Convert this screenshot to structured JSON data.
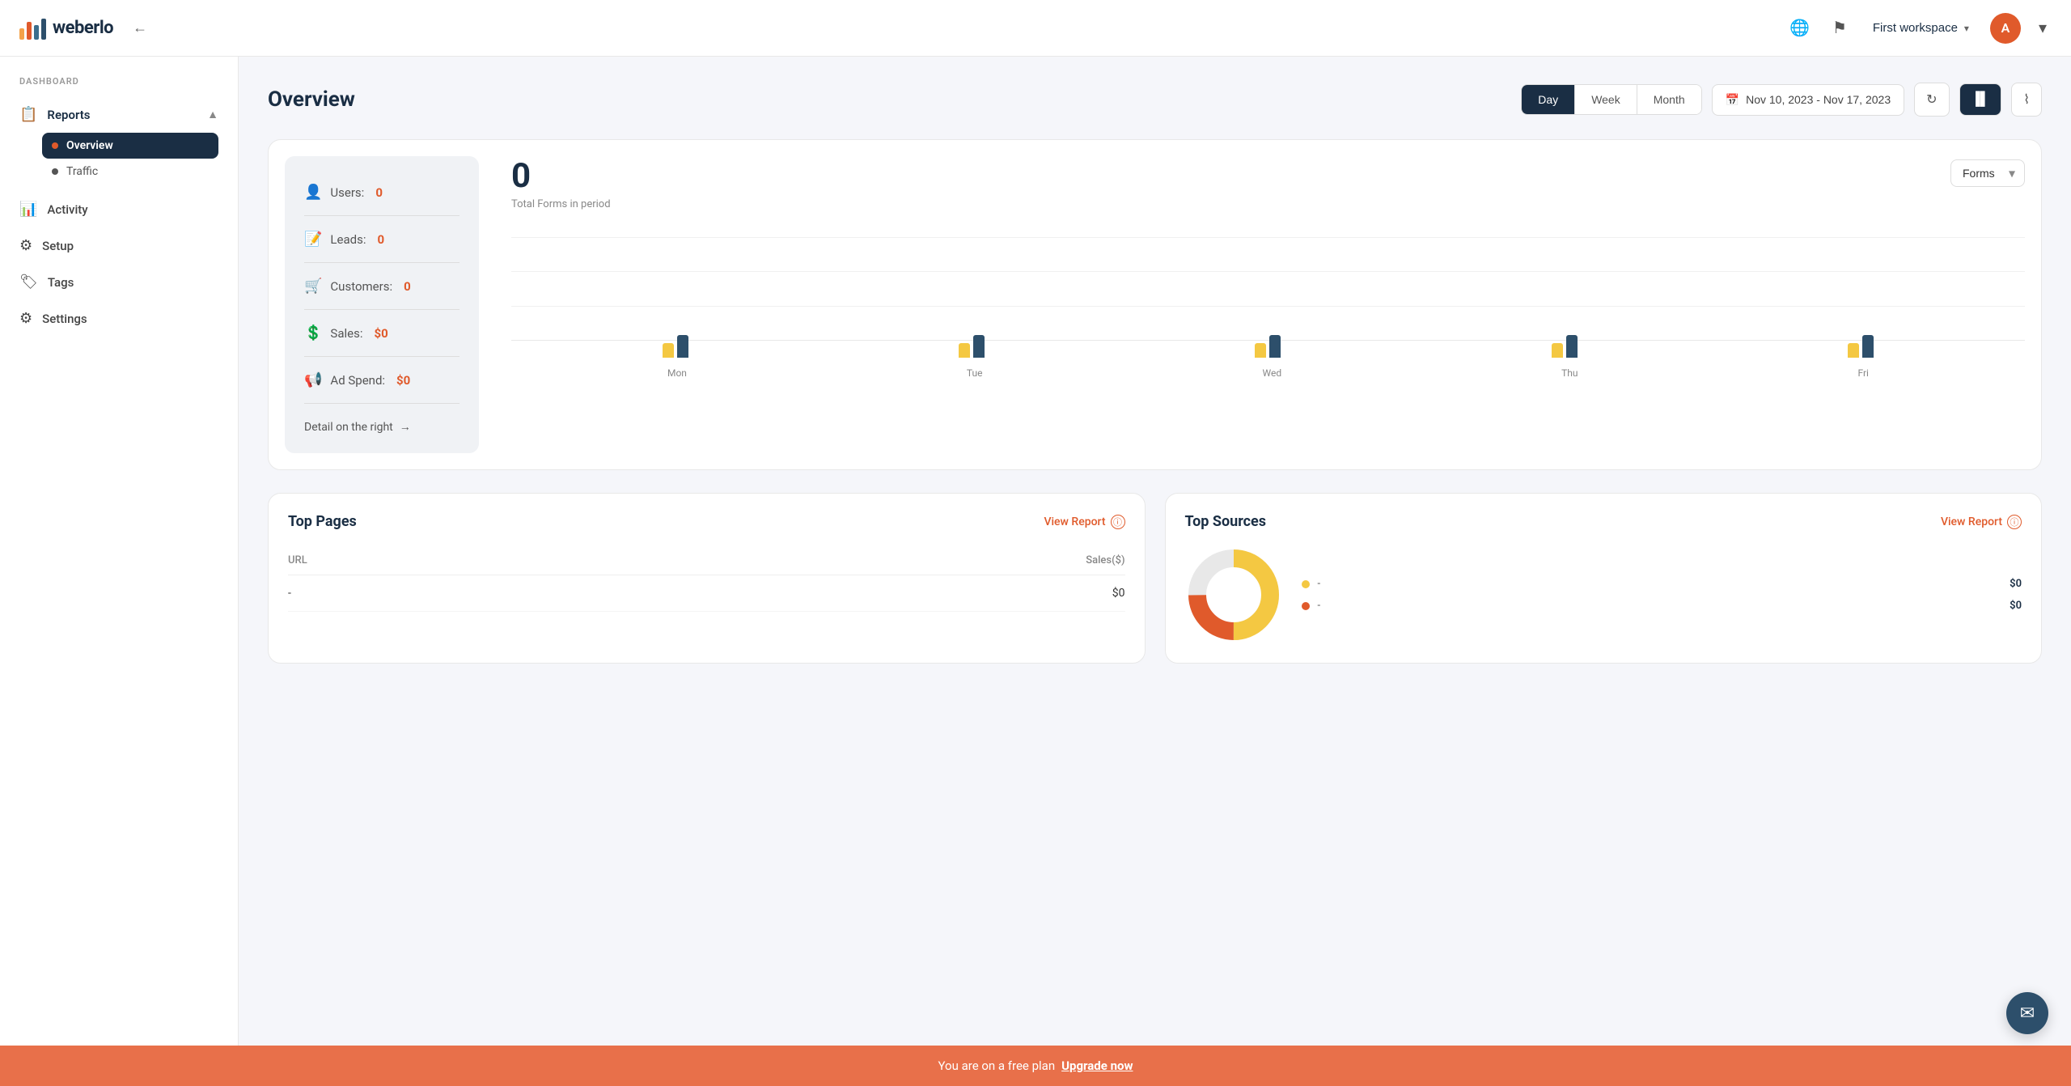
{
  "topbar": {
    "logo_text": "weberlo",
    "back_label": "←",
    "workspace_name": "First workspace",
    "avatar_letter": "A"
  },
  "sidebar": {
    "section_label": "DASHBOARD",
    "items": [
      {
        "id": "reports",
        "label": "Reports",
        "icon": "📋",
        "expanded": true
      },
      {
        "id": "overview",
        "label": "Overview",
        "active": true
      },
      {
        "id": "traffic",
        "label": "Traffic"
      },
      {
        "id": "activity",
        "label": "Activity",
        "icon": "📊"
      },
      {
        "id": "setup",
        "label": "Setup",
        "icon": "⚙"
      },
      {
        "id": "tags",
        "label": "Tags",
        "icon": "🏷"
      },
      {
        "id": "settings",
        "label": "Settings",
        "icon": "⚙"
      }
    ]
  },
  "overview": {
    "title": "Overview",
    "period_buttons": [
      "Day",
      "Week",
      "Month"
    ],
    "active_period": "Day",
    "date_range": "Nov 10, 2023 - Nov 17, 2023",
    "stats": {
      "users_label": "Users:",
      "users_value": "0",
      "leads_label": "Leads:",
      "leads_value": "0",
      "customers_label": "Customers:",
      "customers_value": "0",
      "sales_label": "Sales:",
      "sales_value": "$0",
      "ad_spend_label": "Ad Spend:",
      "ad_spend_value": "$0",
      "detail_link": "Detail on the right"
    },
    "chart": {
      "total": "0",
      "subtitle": "Total Forms in period",
      "dropdown_label": "Forms",
      "days": [
        "Mon",
        "Tue",
        "Wed",
        "Thu",
        "Fri"
      ],
      "bars": [
        {
          "day": "Mon",
          "yellow": 20,
          "dark": 30
        },
        {
          "day": "Tue",
          "yellow": 20,
          "dark": 30
        },
        {
          "day": "Wed",
          "yellow": 20,
          "dark": 30
        },
        {
          "day": "Thu",
          "yellow": 20,
          "dark": 30
        },
        {
          "day": "Fri",
          "yellow": 20,
          "dark": 30
        }
      ]
    }
  },
  "top_pages": {
    "title": "Top Pages",
    "view_report": "View Report",
    "col_url": "URL",
    "col_sales": "Sales($)",
    "rows": [
      {
        "url": "-",
        "sales": "$0"
      }
    ]
  },
  "top_sources": {
    "title": "Top Sources",
    "view_report": "View Report",
    "legend": [
      {
        "color": "#f4c842",
        "label": "-",
        "value": "$0"
      },
      {
        "color": "#e05a2b",
        "label": "-",
        "value": "$0"
      }
    ]
  },
  "free_plan_banner": {
    "message": "You are on a free plan",
    "upgrade_text": "Upgrade now"
  },
  "icons": {
    "calendar": "📅",
    "refresh": "↻",
    "chart_bar": "▐▌",
    "chart_line": "⌇",
    "globe": "🌐",
    "flag": "⚑",
    "chat": "✉"
  }
}
